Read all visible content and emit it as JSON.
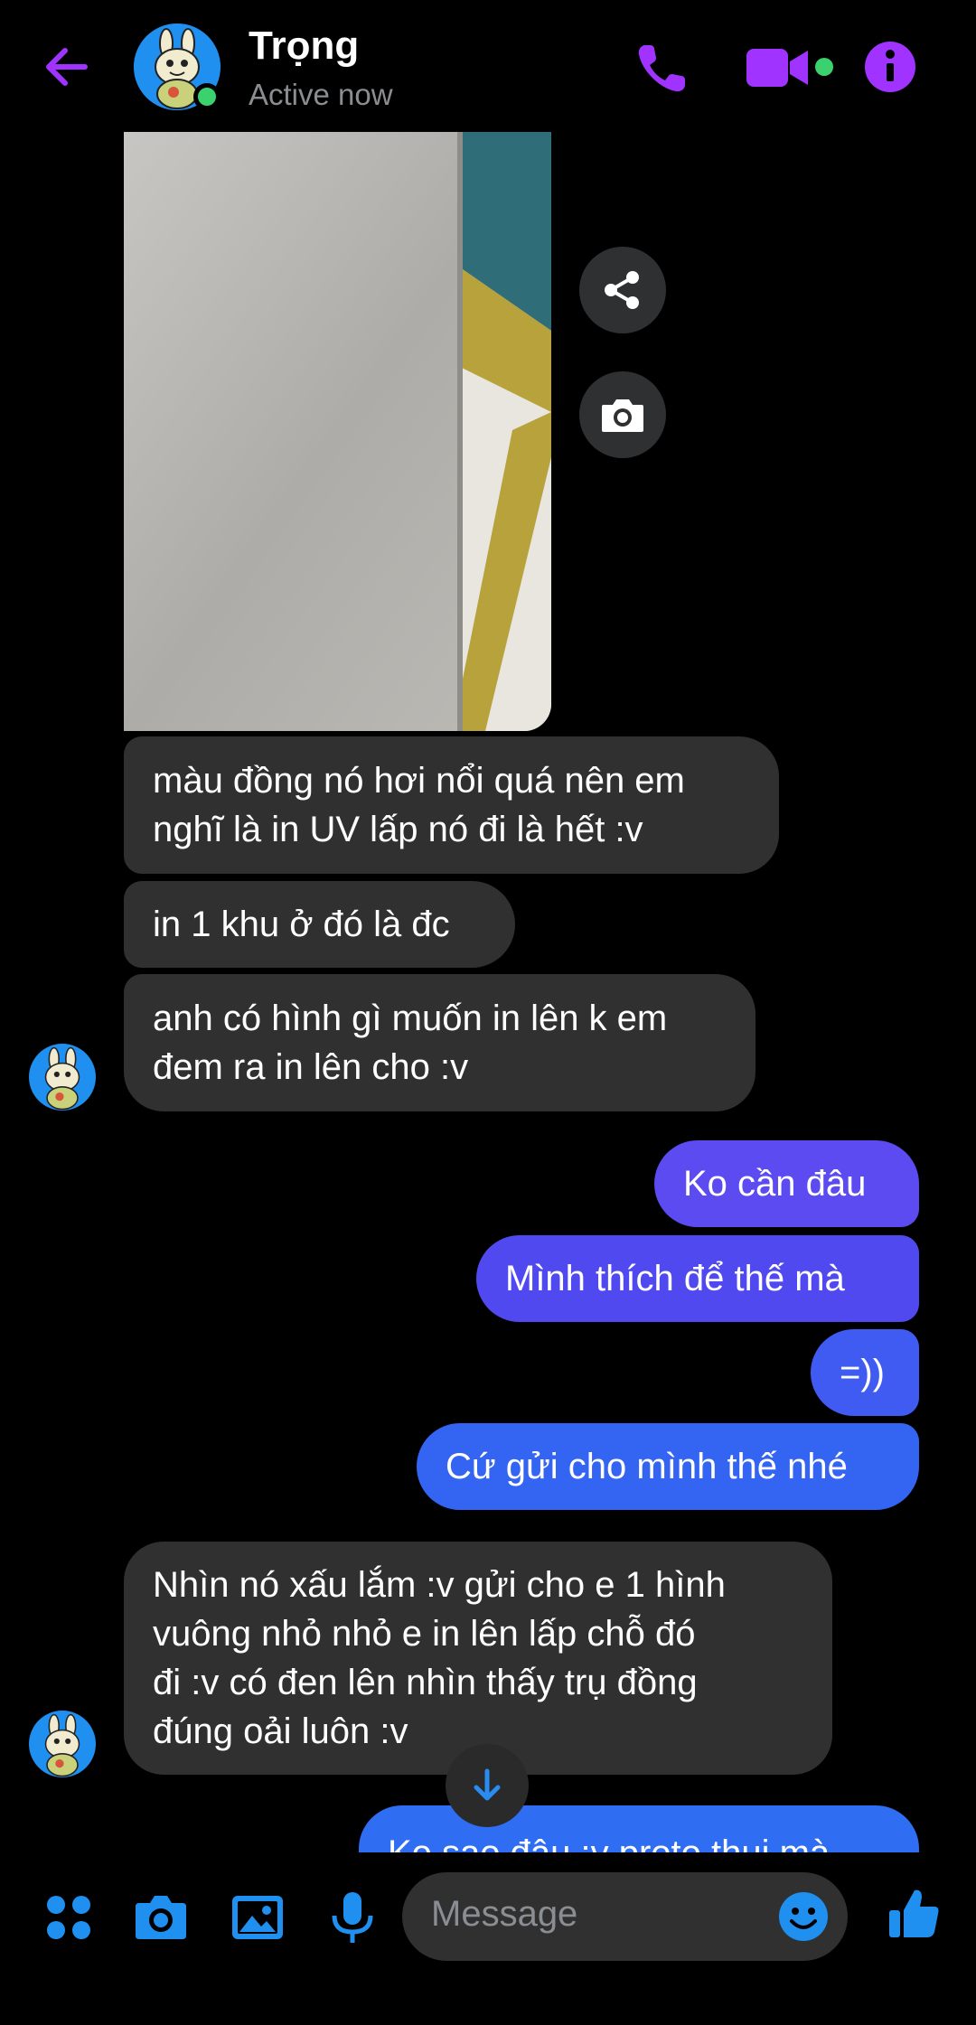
{
  "header": {
    "contact_name": "Trọng",
    "status": "Active now"
  },
  "messages": [
    {
      "direction": "in",
      "text_lines": [
        "màu đồng nó hơi nổi quá nên em",
        "nghĩ là in UV lấp nó đi là hết :v"
      ]
    },
    {
      "direction": "in",
      "text_lines": [
        "in 1 khu ở đó là đc"
      ]
    },
    {
      "direction": "in",
      "text_lines": [
        "anh có hình gì muốn in lên k em",
        "đem ra in lên cho :v"
      ]
    },
    {
      "direction": "out",
      "text_lines": [
        "Ko cần đâu"
      ]
    },
    {
      "direction": "out",
      "text_lines": [
        "Mình thích để thế mà"
      ]
    },
    {
      "direction": "out",
      "text_lines": [
        "=))"
      ]
    },
    {
      "direction": "out",
      "text_lines": [
        "Cứ gửi cho mình thế nhé"
      ]
    },
    {
      "direction": "in",
      "text_lines": [
        "Nhìn nó xấu lắm :v gửi cho e 1 hình",
        "vuông nhỏ nhỏ e in lên lấp chỗ đó",
        "đi :v có đen lên nhìn thấy trụ đồng",
        "đúng oải luôn :v"
      ]
    },
    {
      "direction": "out",
      "text_lines": [
        "Ko sao đâu :v proto thui mà"
      ]
    }
  ],
  "composer": {
    "placeholder": "Message"
  },
  "colors": {
    "accent_purple": "#a033ff",
    "incoming_bubble": "#303030",
    "outgoing_top": "#5b4bf0",
    "outgoing_bottom": "#2f6ef2",
    "online_green": "#3bd16f",
    "composer_blue": "#1f8ff0"
  }
}
